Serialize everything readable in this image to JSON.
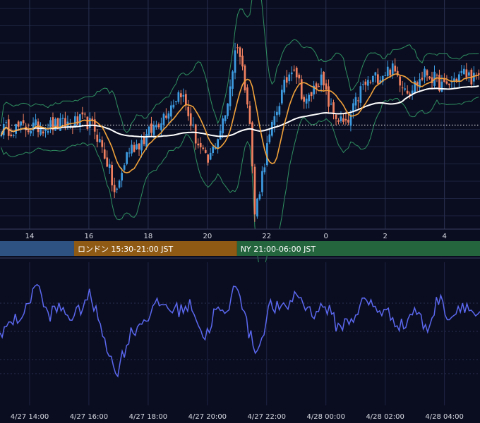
{
  "chart_data": [
    {
      "type": "candlestick",
      "x_ticks": [
        "14",
        "16",
        "18",
        "20",
        "22",
        "0",
        "2",
        "4"
      ],
      "x_range": [
        13.0,
        29.2
      ],
      "y_range": [
        0,
        100
      ],
      "candle_colors": {
        "up": "#3d9be0",
        "down": "#f08060"
      },
      "overlays": [
        {
          "kind": "bollinger_upper",
          "color": "#2f8f60"
        },
        {
          "kind": "bollinger_lower",
          "color": "#2f8f60"
        },
        {
          "kind": "moving_average_fast",
          "color": "#f2a23a"
        },
        {
          "kind": "moving_average_slow",
          "color": "#ffffff"
        },
        {
          "kind": "reference_level",
          "color": "#ffffff",
          "style": "dotted",
          "value": 46
        }
      ],
      "key_points": [
        {
          "x": 13.0,
          "y": 44
        },
        {
          "x": 15.0,
          "y": 46
        },
        {
          "x": 15.9,
          "y": 48
        },
        {
          "x": 16.2,
          "y": 44
        },
        {
          "x": 16.6,
          "y": 30
        },
        {
          "x": 16.9,
          "y": 13
        },
        {
          "x": 17.3,
          "y": 34
        },
        {
          "x": 17.9,
          "y": 40
        },
        {
          "x": 18.6,
          "y": 52
        },
        {
          "x": 19.1,
          "y": 62
        },
        {
          "x": 19.6,
          "y": 40
        },
        {
          "x": 20.0,
          "y": 28
        },
        {
          "x": 20.6,
          "y": 50
        },
        {
          "x": 21.0,
          "y": 85
        },
        {
          "x": 21.4,
          "y": 55
        },
        {
          "x": 21.6,
          "y": 5
        },
        {
          "x": 22.0,
          "y": 35
        },
        {
          "x": 22.4,
          "y": 56
        },
        {
          "x": 22.9,
          "y": 75
        },
        {
          "x": 23.3,
          "y": 55
        },
        {
          "x": 23.8,
          "y": 68
        },
        {
          "x": 24.2,
          "y": 52
        },
        {
          "x": 24.7,
          "y": 45
        },
        {
          "x": 25.2,
          "y": 63
        },
        {
          "x": 25.7,
          "y": 68
        },
        {
          "x": 26.2,
          "y": 72
        },
        {
          "x": 26.8,
          "y": 62
        },
        {
          "x": 27.4,
          "y": 70
        },
        {
          "x": 28.0,
          "y": 63
        },
        {
          "x": 28.6,
          "y": 70
        },
        {
          "x": 29.2,
          "y": 66
        }
      ],
      "sessions": [
        {
          "label": "",
          "color": "#2e5281",
          "start": 13.0,
          "end": 15.5
        },
        {
          "label": "ロンドン 15:30-21:00 JST",
          "color": "#8f5a14",
          "start": 15.5,
          "end": 21.0
        },
        {
          "label": "NY 21:00-06:00 JST",
          "color": "#24653e",
          "start": 21.0,
          "end": 29.2
        }
      ]
    },
    {
      "type": "line",
      "x_ticks": [
        "4/27 14:00",
        "4/27 16:00",
        "4/27 18:00",
        "4/27 20:00",
        "4/27 22:00",
        "4/28 00:00",
        "4/28 02:00",
        "4/28 04:00"
      ],
      "x_range": [
        13.0,
        29.2
      ],
      "y_range": [
        0,
        100
      ],
      "series": [
        {
          "color": "#5b68ef",
          "points": [
            {
              "x": 13.0,
              "y": 52
            },
            {
              "x": 13.5,
              "y": 60
            },
            {
              "x": 13.9,
              "y": 68
            },
            {
              "x": 14.2,
              "y": 92
            },
            {
              "x": 14.6,
              "y": 64
            },
            {
              "x": 15.0,
              "y": 70
            },
            {
              "x": 15.5,
              "y": 62
            },
            {
              "x": 16.0,
              "y": 80
            },
            {
              "x": 16.4,
              "y": 58
            },
            {
              "x": 16.9,
              "y": 18
            },
            {
              "x": 17.4,
              "y": 50
            },
            {
              "x": 17.9,
              "y": 62
            },
            {
              "x": 18.4,
              "y": 74
            },
            {
              "x": 18.9,
              "y": 68
            },
            {
              "x": 19.5,
              "y": 72
            },
            {
              "x": 19.9,
              "y": 45
            },
            {
              "x": 20.3,
              "y": 70
            },
            {
              "x": 20.6,
              "y": 62
            },
            {
              "x": 21.0,
              "y": 92
            },
            {
              "x": 21.4,
              "y": 50
            },
            {
              "x": 21.7,
              "y": 36
            },
            {
              "x": 22.1,
              "y": 72
            },
            {
              "x": 22.6,
              "y": 68
            },
            {
              "x": 23.0,
              "y": 82
            },
            {
              "x": 23.5,
              "y": 66
            },
            {
              "x": 24.0,
              "y": 72
            },
            {
              "x": 24.4,
              "y": 55
            },
            {
              "x": 24.9,
              "y": 62
            },
            {
              "x": 25.3,
              "y": 76
            },
            {
              "x": 25.7,
              "y": 70
            },
            {
              "x": 26.2,
              "y": 64
            },
            {
              "x": 26.6,
              "y": 55
            },
            {
              "x": 27.0,
              "y": 70
            },
            {
              "x": 27.4,
              "y": 52
            },
            {
              "x": 27.8,
              "y": 78
            },
            {
              "x": 28.2,
              "y": 62
            },
            {
              "x": 28.6,
              "y": 74
            },
            {
              "x": 29.2,
              "y": 62
            }
          ]
        }
      ]
    }
  ]
}
